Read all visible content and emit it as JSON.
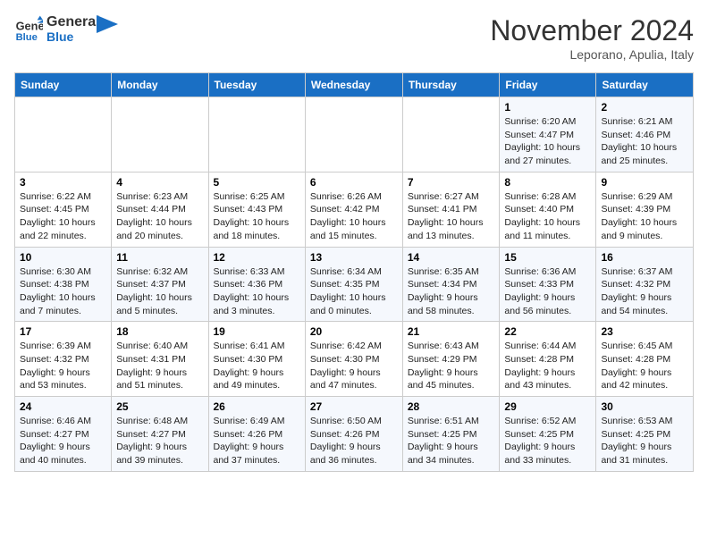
{
  "header": {
    "logo_line1": "General",
    "logo_line2": "Blue",
    "month": "November 2024",
    "location": "Leporano, Apulia, Italy"
  },
  "days_of_week": [
    "Sunday",
    "Monday",
    "Tuesday",
    "Wednesday",
    "Thursday",
    "Friday",
    "Saturday"
  ],
  "weeks": [
    [
      {
        "day": "",
        "info": ""
      },
      {
        "day": "",
        "info": ""
      },
      {
        "day": "",
        "info": ""
      },
      {
        "day": "",
        "info": ""
      },
      {
        "day": "",
        "info": ""
      },
      {
        "day": "1",
        "info": "Sunrise: 6:20 AM\nSunset: 4:47 PM\nDaylight: 10 hours and 27 minutes."
      },
      {
        "day": "2",
        "info": "Sunrise: 6:21 AM\nSunset: 4:46 PM\nDaylight: 10 hours and 25 minutes."
      }
    ],
    [
      {
        "day": "3",
        "info": "Sunrise: 6:22 AM\nSunset: 4:45 PM\nDaylight: 10 hours and 22 minutes."
      },
      {
        "day": "4",
        "info": "Sunrise: 6:23 AM\nSunset: 4:44 PM\nDaylight: 10 hours and 20 minutes."
      },
      {
        "day": "5",
        "info": "Sunrise: 6:25 AM\nSunset: 4:43 PM\nDaylight: 10 hours and 18 minutes."
      },
      {
        "day": "6",
        "info": "Sunrise: 6:26 AM\nSunset: 4:42 PM\nDaylight: 10 hours and 15 minutes."
      },
      {
        "day": "7",
        "info": "Sunrise: 6:27 AM\nSunset: 4:41 PM\nDaylight: 10 hours and 13 minutes."
      },
      {
        "day": "8",
        "info": "Sunrise: 6:28 AM\nSunset: 4:40 PM\nDaylight: 10 hours and 11 minutes."
      },
      {
        "day": "9",
        "info": "Sunrise: 6:29 AM\nSunset: 4:39 PM\nDaylight: 10 hours and 9 minutes."
      }
    ],
    [
      {
        "day": "10",
        "info": "Sunrise: 6:30 AM\nSunset: 4:38 PM\nDaylight: 10 hours and 7 minutes."
      },
      {
        "day": "11",
        "info": "Sunrise: 6:32 AM\nSunset: 4:37 PM\nDaylight: 10 hours and 5 minutes."
      },
      {
        "day": "12",
        "info": "Sunrise: 6:33 AM\nSunset: 4:36 PM\nDaylight: 10 hours and 3 minutes."
      },
      {
        "day": "13",
        "info": "Sunrise: 6:34 AM\nSunset: 4:35 PM\nDaylight: 10 hours and 0 minutes."
      },
      {
        "day": "14",
        "info": "Sunrise: 6:35 AM\nSunset: 4:34 PM\nDaylight: 9 hours and 58 minutes."
      },
      {
        "day": "15",
        "info": "Sunrise: 6:36 AM\nSunset: 4:33 PM\nDaylight: 9 hours and 56 minutes."
      },
      {
        "day": "16",
        "info": "Sunrise: 6:37 AM\nSunset: 4:32 PM\nDaylight: 9 hours and 54 minutes."
      }
    ],
    [
      {
        "day": "17",
        "info": "Sunrise: 6:39 AM\nSunset: 4:32 PM\nDaylight: 9 hours and 53 minutes."
      },
      {
        "day": "18",
        "info": "Sunrise: 6:40 AM\nSunset: 4:31 PM\nDaylight: 9 hours and 51 minutes."
      },
      {
        "day": "19",
        "info": "Sunrise: 6:41 AM\nSunset: 4:30 PM\nDaylight: 9 hours and 49 minutes."
      },
      {
        "day": "20",
        "info": "Sunrise: 6:42 AM\nSunset: 4:30 PM\nDaylight: 9 hours and 47 minutes."
      },
      {
        "day": "21",
        "info": "Sunrise: 6:43 AM\nSunset: 4:29 PM\nDaylight: 9 hours and 45 minutes."
      },
      {
        "day": "22",
        "info": "Sunrise: 6:44 AM\nSunset: 4:28 PM\nDaylight: 9 hours and 43 minutes."
      },
      {
        "day": "23",
        "info": "Sunrise: 6:45 AM\nSunset: 4:28 PM\nDaylight: 9 hours and 42 minutes."
      }
    ],
    [
      {
        "day": "24",
        "info": "Sunrise: 6:46 AM\nSunset: 4:27 PM\nDaylight: 9 hours and 40 minutes."
      },
      {
        "day": "25",
        "info": "Sunrise: 6:48 AM\nSunset: 4:27 PM\nDaylight: 9 hours and 39 minutes."
      },
      {
        "day": "26",
        "info": "Sunrise: 6:49 AM\nSunset: 4:26 PM\nDaylight: 9 hours and 37 minutes."
      },
      {
        "day": "27",
        "info": "Sunrise: 6:50 AM\nSunset: 4:26 PM\nDaylight: 9 hours and 36 minutes."
      },
      {
        "day": "28",
        "info": "Sunrise: 6:51 AM\nSunset: 4:25 PM\nDaylight: 9 hours and 34 minutes."
      },
      {
        "day": "29",
        "info": "Sunrise: 6:52 AM\nSunset: 4:25 PM\nDaylight: 9 hours and 33 minutes."
      },
      {
        "day": "30",
        "info": "Sunrise: 6:53 AM\nSunset: 4:25 PM\nDaylight: 9 hours and 31 minutes."
      }
    ]
  ]
}
